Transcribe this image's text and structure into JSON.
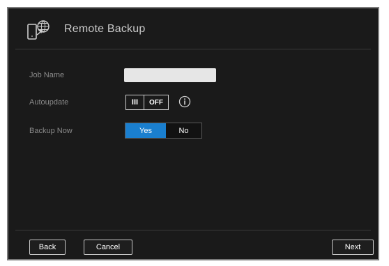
{
  "dialog": {
    "title": "Remote Backup",
    "header_icon": "remote-backup-icon"
  },
  "form": {
    "job_name": {
      "label": "Job Name",
      "value": ""
    },
    "autoupdate": {
      "label": "Autoupdate",
      "handle_glyph": "III",
      "state_text": "OFF",
      "info_icon": "info-icon"
    },
    "backup_now": {
      "label": "Backup Now",
      "options": [
        "Yes",
        "No"
      ],
      "selected": "Yes"
    }
  },
  "footer": {
    "back_label": "Back",
    "cancel_label": "Cancel",
    "next_label": "Next"
  },
  "colors": {
    "background": "#1a1a1a",
    "accent": "#1a7fcf",
    "label": "#8a8a8a",
    "title": "#c8c8c8"
  }
}
